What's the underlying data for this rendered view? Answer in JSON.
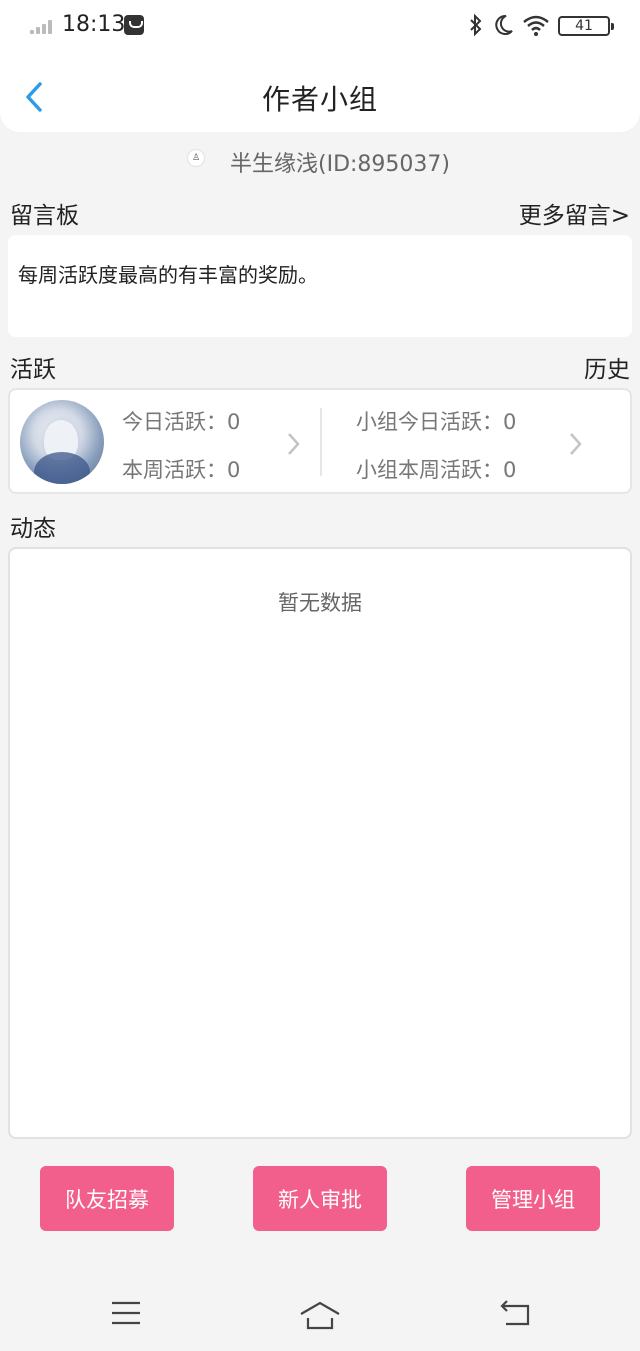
{
  "status_bar": {
    "time": "18:13",
    "battery": "41",
    "icons": [
      "signal-icon",
      "notification-icon",
      "bluetooth-icon",
      "moon-icon",
      "wifi-icon",
      "battery-icon"
    ]
  },
  "header": {
    "title": "作者小组",
    "back_icon": "chevron-left-icon"
  },
  "author": {
    "name": "半生缘浅(ID:895037)"
  },
  "board": {
    "title": "留言板",
    "more_label": "更多留言>",
    "message": "每周活跃度最高的有丰富的奖励。"
  },
  "activity": {
    "title": "活跃",
    "history_label": "历史",
    "today": "今日活跃：0",
    "week": "本周活跃：0",
    "group_today": "小组今日活跃：0",
    "group_week": "小组本周活跃：0"
  },
  "feed": {
    "title": "动态",
    "empty_text": "暂无数据"
  },
  "buttons": {
    "recruit": "队友招募",
    "approve": "新人审批",
    "manage": "管理小组"
  },
  "colors": {
    "accent_blue": "#2f9be8",
    "button_pink": "#f25f8c",
    "background": "#f4f4f4"
  }
}
